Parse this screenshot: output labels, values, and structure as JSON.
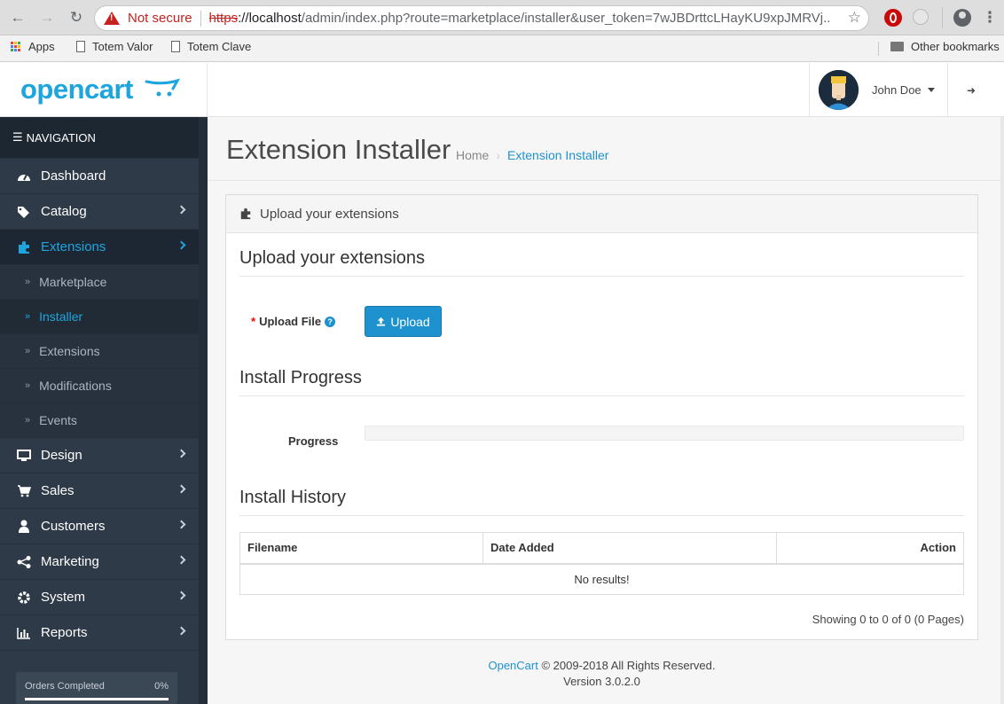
{
  "browser": {
    "not_secure": "Not secure",
    "url_scheme": "https",
    "url_host": "://localhost",
    "url_path": "/admin/index.php?route=marketplace/installer&user_token=7wJBDrttcLHayKU9xpJMRVj...",
    "bookmarks": [
      "Apps",
      "Totem Valor",
      "Totem Clave"
    ],
    "other_bookmarks": "Other bookmarks"
  },
  "header": {
    "logo": "opencart",
    "user_name": "John Doe"
  },
  "sidebar": {
    "nav_title": "NAVIGATION",
    "items": [
      {
        "label": "Dashboard",
        "icon": "dashboard-icon"
      },
      {
        "label": "Catalog",
        "icon": "tags-icon"
      },
      {
        "label": "Extensions",
        "icon": "puzzle-icon"
      },
      {
        "label": "Design",
        "icon": "monitor-icon"
      },
      {
        "label": "Sales",
        "icon": "cart-icon"
      },
      {
        "label": "Customers",
        "icon": "user-icon"
      },
      {
        "label": "Marketing",
        "icon": "share-icon"
      },
      {
        "label": "System",
        "icon": "gear-icon"
      },
      {
        "label": "Reports",
        "icon": "bar-chart-icon"
      }
    ],
    "sub_items": [
      "Marketplace",
      "Installer",
      "Extensions",
      "Modifications",
      "Events"
    ],
    "orders_completed": {
      "label": "Orders Completed",
      "percent": "0%"
    }
  },
  "page": {
    "title": "Extension Installer",
    "breadcrumb": [
      "Home",
      "Extension Installer"
    ],
    "panel_title": "Upload your extensions",
    "upload_section": "Upload your extensions",
    "upload_label": "Upload File",
    "upload_button": "Upload",
    "progress_section": "Install Progress",
    "progress_label": "Progress",
    "progress_value": 0,
    "history_section": "Install History",
    "table_headers": [
      "Filename",
      "Date Added",
      "Action"
    ],
    "no_results": "No results!",
    "showing": "Showing 0 to 0 of 0 (0 Pages)"
  },
  "footer": {
    "brand": "OpenCart",
    "copyright": " © 2009-2018 All Rights Reserved.",
    "version": "Version 3.0.2.0"
  },
  "colors": {
    "accent": "#1e91cf",
    "sidebar": "#2e3a47"
  }
}
